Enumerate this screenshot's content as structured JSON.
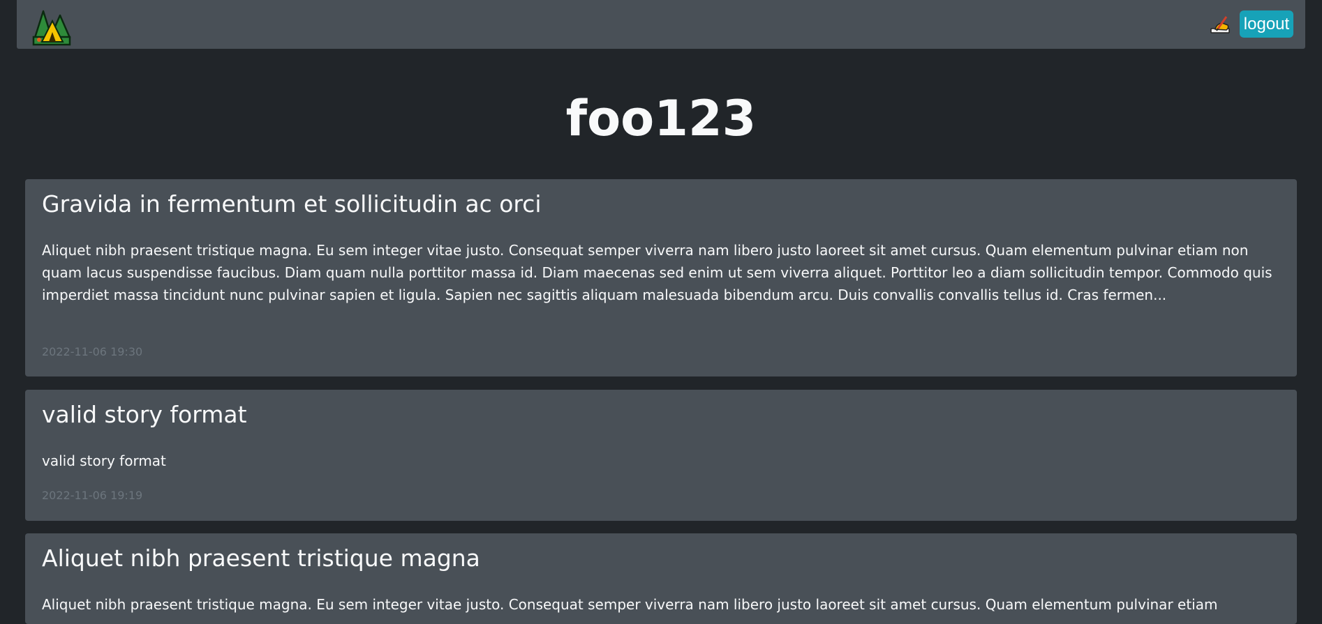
{
  "navbar": {
    "logo_icon": "camping-tent-icon",
    "write_icon": "writing-hand-icon",
    "logout_label": "logout",
    "accent_color": "#17a2b8"
  },
  "page": {
    "title": "foo123"
  },
  "stories": [
    {
      "title": "Gravida in fermentum et sollicitudin ac orci",
      "body": "Aliquet nibh praesent tristique magna. Eu sem integer vitae justo. Consequat semper viverra nam libero justo laoreet sit amet cursus. Quam elementum pulvinar etiam non quam lacus suspendisse faucibus. Diam quam nulla porttitor massa id. Diam maecenas sed enim ut sem viverra aliquet. Porttitor leo a diam sollicitudin tempor. Commodo quis imperdiet massa tincidunt nunc pulvinar sapien et ligula. Sapien nec sagittis aliquam malesuada bibendum arcu. Duis convallis convallis tellus id. Cras fermen...",
      "date": "2022-11-06 19:30"
    },
    {
      "title": "valid story format",
      "body": "valid story format",
      "date": "2022-11-06 19:19"
    },
    {
      "title": "Aliquet nibh praesent tristique magna",
      "body": "Aliquet nibh praesent tristique magna. Eu sem integer vitae justo. Consequat semper viverra nam libero justo laoreet sit amet cursus. Quam elementum pulvinar etiam"
    }
  ]
}
